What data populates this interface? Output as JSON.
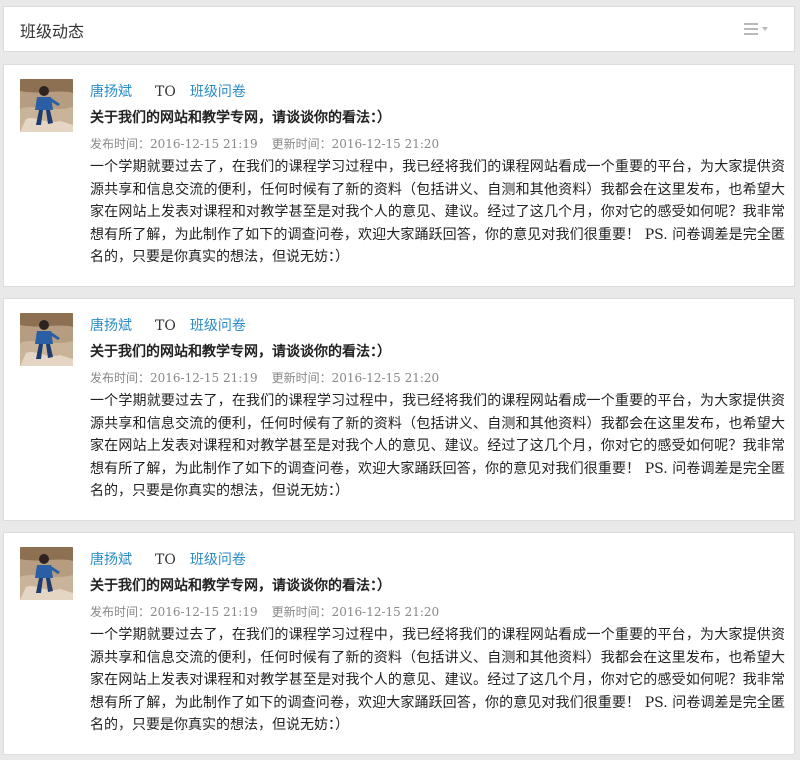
{
  "header": {
    "title": "班级动态"
  },
  "posts": [
    {
      "author": "唐扬斌",
      "to": "TO",
      "group": "班级问卷",
      "title": "关于我们的网站和教学专网，请谈谈你的看法：）",
      "published": "发布时间：2016-12-15 21:19",
      "updated": "更新时间：2016-12-15 21:20",
      "content": "一个学期就要过去了，在我们的课程学习过程中，我已经将我们的课程网站看成一个重要的平台，为大家提供资源共享和信息交流的便利，任何时候有了新的资料（包括讲义、自测和其他资料）我都会在这里发布，也希望大家在网站上发表对课程和对教学甚至是对我个人的意见、建议。经过了这几个月，你对它的感受如何呢？我非常想有所了解，为此制作了如下的调查问卷，欢迎大家踊跃回答，你的意见对我们很重要！ PS. 问卷调差是完全匿名的，只要是你真实的想法，但说无妨：）"
    },
    {
      "author": "唐扬斌",
      "to": "TO",
      "group": "班级问卷",
      "title": "关于我们的网站和教学专网，请谈谈你的看法：）",
      "published": "发布时间：2016-12-15 21:19",
      "updated": "更新时间：2016-12-15 21:20",
      "content": "一个学期就要过去了，在我们的课程学习过程中，我已经将我们的课程网站看成一个重要的平台，为大家提供资源共享和信息交流的便利，任何时候有了新的资料（包括讲义、自测和其他资料）我都会在这里发布，也希望大家在网站上发表对课程和对教学甚至是对我个人的意见、建议。经过了这几个月，你对它的感受如何呢？我非常想有所了解，为此制作了如下的调查问卷，欢迎大家踊跃回答，你的意见对我们很重要！ PS. 问卷调差是完全匿名的，只要是你真实的想法，但说无妨：）"
    },
    {
      "author": "唐扬斌",
      "to": "TO",
      "group": "班级问卷",
      "title": "关于我们的网站和教学专网，请谈谈你的看法：）",
      "published": "发布时间：2016-12-15 21:19",
      "updated": "更新时间：2016-12-15 21:20",
      "content": "一个学期就要过去了，在我们的课程学习过程中，我已经将我们的课程网站看成一个重要的平台，为大家提供资源共享和信息交流的便利，任何时候有了新的资料（包括讲义、自测和其他资料）我都会在这里发布，也希望大家在网站上发表对课程和对教学甚至是对我个人的意见、建议。经过了这几个月，你对它的感受如何呢？我非常想有所了解，为此制作了如下的调查问卷，欢迎大家踊跃回答，你的意见对我们很重要！ PS. 问卷调差是完全匿名的，只要是你真实的想法，但说无妨：）"
    }
  ]
}
